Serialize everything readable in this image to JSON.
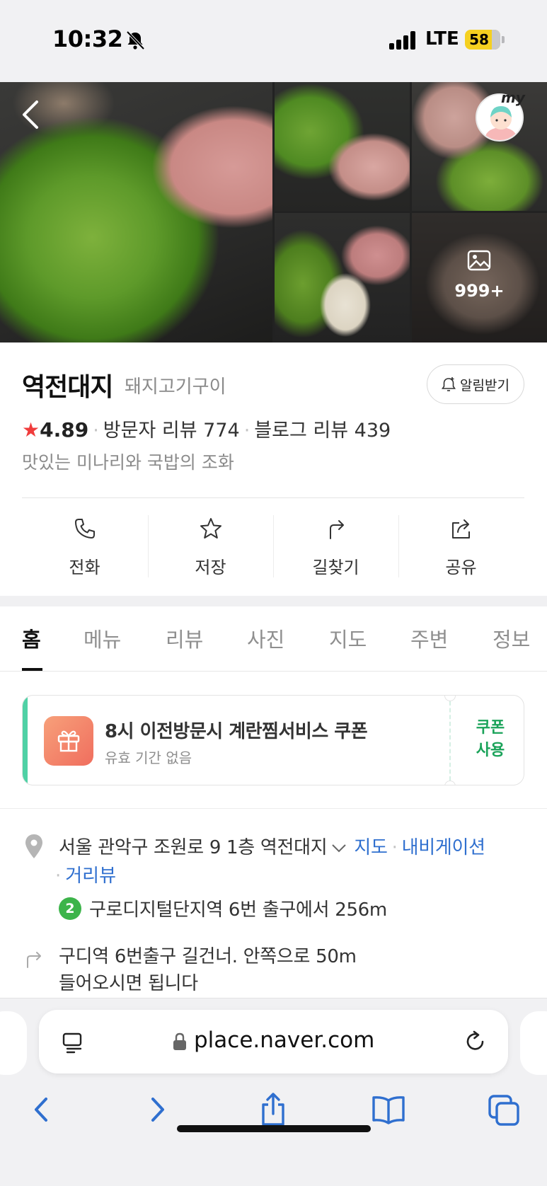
{
  "status_bar": {
    "time": "10:32",
    "network": "LTE",
    "battery": "58",
    "battery_level": 0.58,
    "icons": [
      "bell-off-icon",
      "signal-icon",
      "battery-icon"
    ]
  },
  "photos": {
    "more_count": "999+",
    "profile_badge": "my",
    "icons": [
      "back-arrow-icon",
      "image-icon"
    ]
  },
  "place": {
    "name": "역전대지",
    "category": "돼지고기구이",
    "notify_label": "알림받기",
    "rating_star": "★",
    "rating": "4.89",
    "visitor_reviews": "방문자 리뷰 774",
    "blog_reviews": "블로그 리뷰 439",
    "separator": "·",
    "tagline": "맛있는 미나리와 국밥의 조화"
  },
  "actions": [
    {
      "label": "전화",
      "icon": "phone-icon"
    },
    {
      "label": "저장",
      "icon": "star-icon"
    },
    {
      "label": "길찾기",
      "icon": "directions-icon"
    },
    {
      "label": "공유",
      "icon": "share-icon"
    }
  ],
  "tabs": [
    "홈",
    "메뉴",
    "리뷰",
    "사진",
    "지도",
    "주변",
    "정보"
  ],
  "active_tab": "홈",
  "coupon": {
    "title": "8시 이전방문시 계란찜서비스 쿠폰",
    "subtitle": "유효 기간 없음",
    "use_label_1": "쿠폰",
    "use_label_2": "사용",
    "accent_color": "#4fd1a5",
    "icon": "gift-icon"
  },
  "address": {
    "text": "서울 관악구 조원로 9 1층 역전대지",
    "map_link": "지도",
    "navigation_link": "내비게이션",
    "street_view_link": "거리뷰",
    "separator": "·",
    "subway_line": "2",
    "subway_line_color": "#3cb44a",
    "subway_text": "구로디지털단지역 6번 출구에서 256m",
    "directions_line_1": "구디역 6번출구 길건너. 안쪽으로 50m",
    "directions_line_2": "들어오시면 됩니다"
  },
  "browser": {
    "url": "place.naver.com",
    "link_color": "#2f6fcf",
    "icons": [
      "reader-icon",
      "lock-icon",
      "reload-icon",
      "back-icon",
      "forward-icon",
      "share-icon",
      "bookmarks-icon",
      "tabs-icon"
    ]
  }
}
